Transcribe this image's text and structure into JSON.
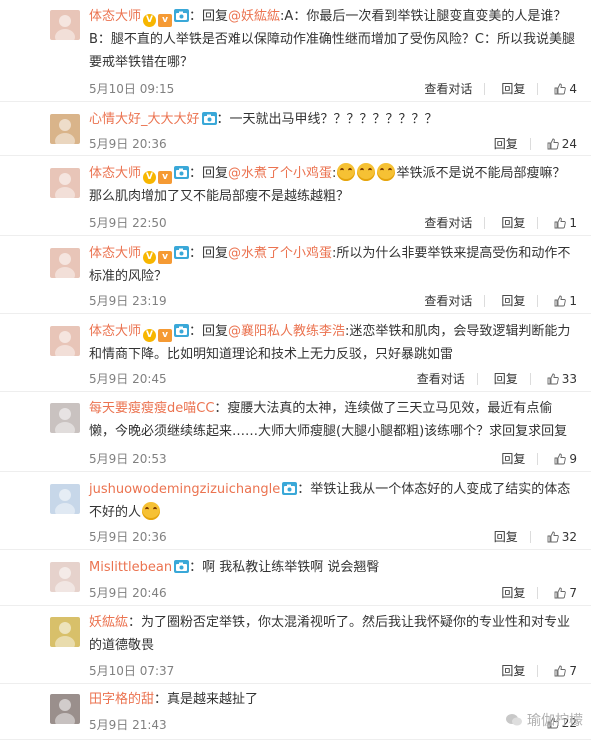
{
  "comments": [
    {
      "user": "体态大师",
      "badges": [
        "v",
        "vip",
        "cam"
      ],
      "avatar_color": "#e8c5b8",
      "parts": [
        {
          "t": "text",
          "v": "：回复"
        },
        {
          "t": "mention",
          "v": "@妖紘紘"
        },
        {
          "t": "text",
          "v": ":A：你最后一次看到举铁让腿变直变美的人是谁？B：腿不直的人举铁是否难以保障动作准确性继而增加了受伤风险？C：所以我说美腿要戒举铁错在哪？"
        }
      ],
      "time": "5月10日 09:15",
      "view_label": "查看对话",
      "reply_label": "回复",
      "likes": "4"
    },
    {
      "user": "心情大好_大大大好",
      "badges": [
        "cam"
      ],
      "avatar_color": "#d9b48a",
      "parts": [
        {
          "t": "text",
          "v": "：一天就出马甲线？？？？？？？？？"
        }
      ],
      "time": "5月9日 20:36",
      "view_label": "",
      "reply_label": "回复",
      "likes": "24"
    },
    {
      "user": "体态大师",
      "badges": [
        "v",
        "vip",
        "cam"
      ],
      "avatar_color": "#e8c5b8",
      "parts": [
        {
          "t": "text",
          "v": "：回复"
        },
        {
          "t": "mention",
          "v": "@水煮了个小鸡蛋"
        },
        {
          "t": "text",
          "v": ":"
        },
        {
          "t": "emoji",
          "v": "laugh"
        },
        {
          "t": "emoji",
          "v": "laugh"
        },
        {
          "t": "emoji",
          "v": "laugh"
        },
        {
          "t": "text",
          "v": "举铁派不是说不能局部瘦嘛？那么肌肉增加了又不能局部瘦不是越练越粗？"
        }
      ],
      "time": "5月9日 22:50",
      "view_label": "查看对话",
      "reply_label": "回复",
      "likes": "1"
    },
    {
      "user": "体态大师",
      "badges": [
        "v",
        "vip",
        "cam"
      ],
      "avatar_color": "#e8c5b8",
      "parts": [
        {
          "t": "text",
          "v": "：回复"
        },
        {
          "t": "mention",
          "v": "@水煮了个小鸡蛋"
        },
        {
          "t": "text",
          "v": ":所以为什么非要举铁来提高受伤和动作不标准的风险？"
        }
      ],
      "time": "5月9日 23:19",
      "view_label": "查看对话",
      "reply_label": "回复",
      "likes": "1"
    },
    {
      "user": "体态大师",
      "badges": [
        "v",
        "vip",
        "cam"
      ],
      "avatar_color": "#e8c5b8",
      "parts": [
        {
          "t": "text",
          "v": "：回复"
        },
        {
          "t": "mention",
          "v": "@襄阳私人教练李浩"
        },
        {
          "t": "text",
          "v": ":迷恋举铁和肌肉，会导致逻辑判断能力和情商下降。比如明知道理论和技术上无力反驳，只好暴跳如雷"
        }
      ],
      "time": "5月9日 20:45",
      "view_label": "查看对话",
      "reply_label": "回复",
      "likes": "33"
    },
    {
      "user": "每天要瘦瘦瘦de喵CC",
      "badges": [],
      "avatar_color": "#c9c2c0",
      "parts": [
        {
          "t": "text",
          "v": "：瘦腰大法真的太神，连续做了三天立马见效，最近有点偷懒，今晚必须继续练起来……大师大师瘦腿(大腿小腿都粗)该练哪个？求回复求回复"
        }
      ],
      "time": "5月9日 20:53",
      "view_label": "",
      "reply_label": "回复",
      "likes": "9"
    },
    {
      "user": "jushuowodemingzizuichangle",
      "badges": [
        "cam"
      ],
      "avatar_color": "#c7d7e9",
      "parts": [
        {
          "t": "text",
          "v": "：举铁让我从一个体态好的人变成了结实的体态不好的人"
        },
        {
          "t": "emoji",
          "v": "think"
        }
      ],
      "time": "5月9日 20:36",
      "view_label": "",
      "reply_label": "回复",
      "likes": "32"
    },
    {
      "user": "Mislittlebean",
      "badges": [
        "cam"
      ],
      "avatar_color": "#e6d2cc",
      "parts": [
        {
          "t": "text",
          "v": "：啊 我私教让练举铁啊 说会翘臀"
        }
      ],
      "time": "5月9日 20:46",
      "view_label": "",
      "reply_label": "回复",
      "likes": "7"
    },
    {
      "user": "妖紘紘",
      "badges": [],
      "avatar_color": "#d8c06a",
      "parts": [
        {
          "t": "text",
          "v": "：为了圈粉否定举铁，你太混淆视听了。然后我让我怀疑你的专业性和对专业的道德敬畏"
        }
      ],
      "time": "5月10日 07:37",
      "view_label": "",
      "reply_label": "回复",
      "likes": "7"
    },
    {
      "user": "田字格的甜",
      "badges": [],
      "avatar_color": "#9a8f8c",
      "parts": [
        {
          "t": "text",
          "v": "：真是越来越扯了"
        }
      ],
      "time": "5月9日 21:43",
      "view_label": "",
      "reply_label": "",
      "likes": "22"
    }
  ],
  "watermark": "瑜伽柠檬",
  "colors": {
    "link": "#eb7350",
    "meta": "#808080",
    "border": "#eeeeee"
  }
}
